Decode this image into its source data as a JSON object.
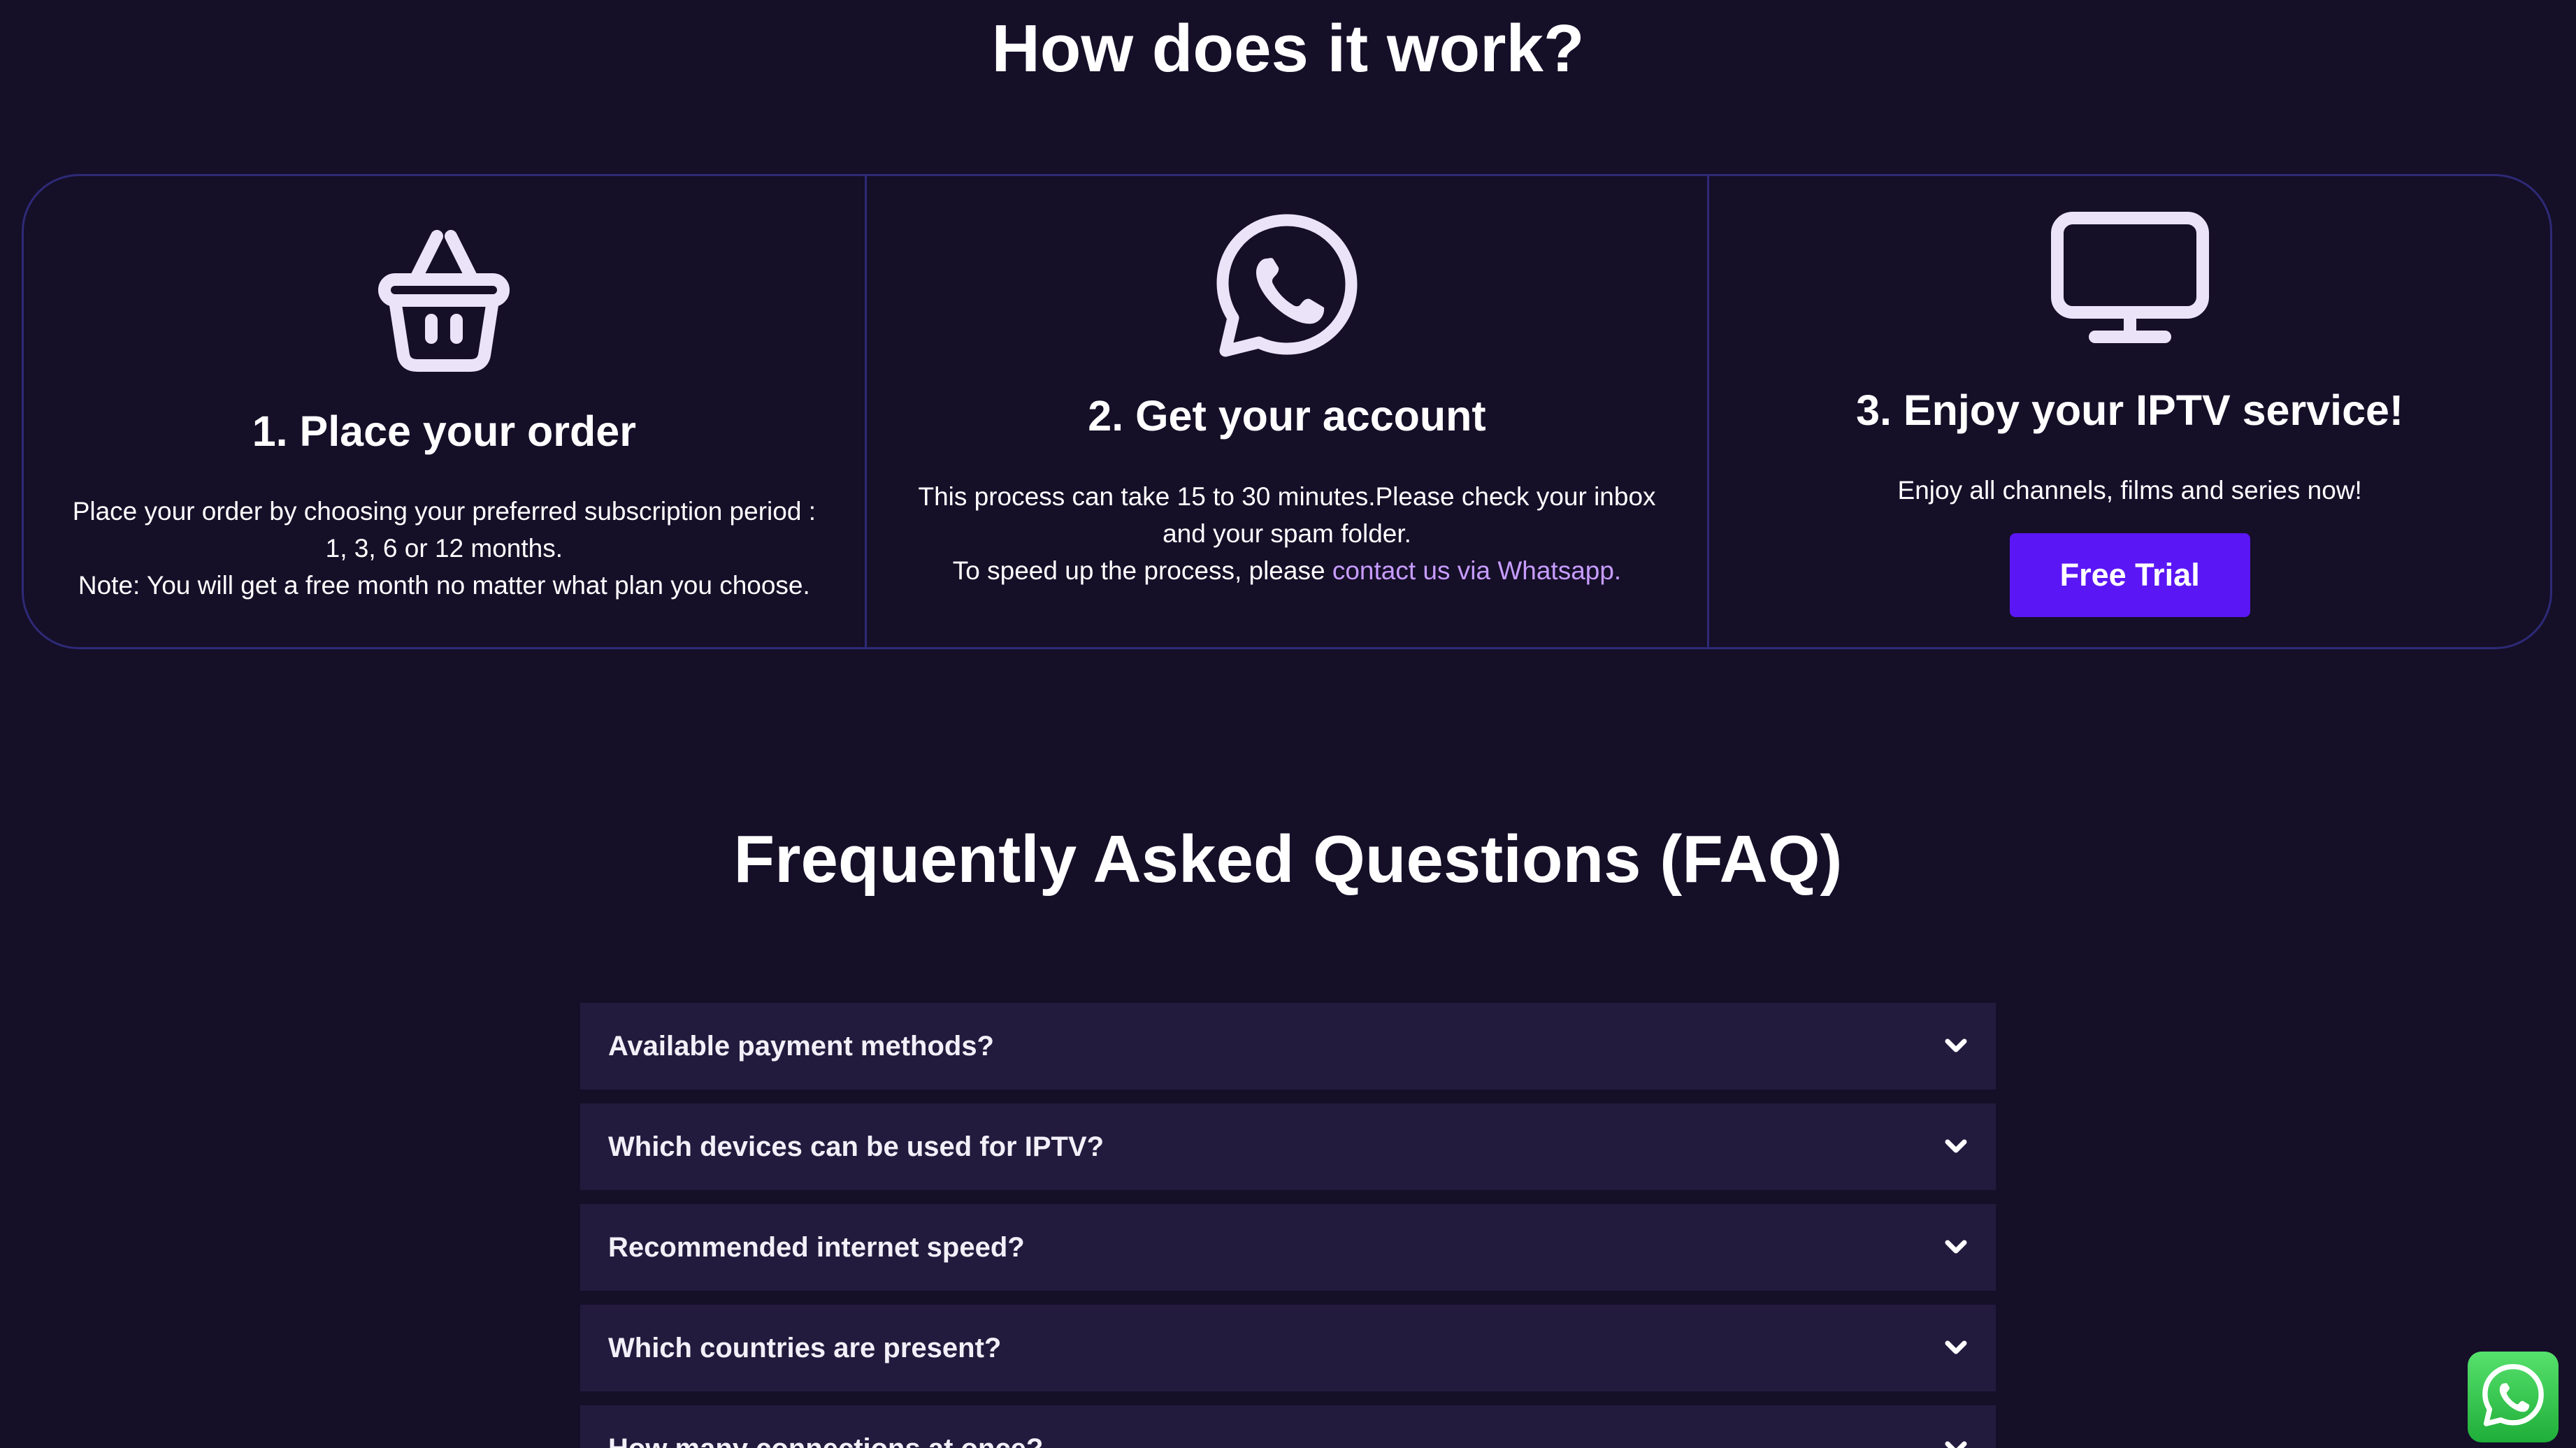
{
  "how_it_works": {
    "title": "How does it work?",
    "steps": [
      {
        "icon": "basket-icon",
        "title": "1. Place your order",
        "description": [
          "Place your order by choosing your preferred subscription period :",
          "1, 3, 6 or 12 months.",
          "Note: You will get a free month no matter what plan you choose."
        ]
      },
      {
        "icon": "whatsapp-icon",
        "title": "2. Get your account",
        "description": [
          "This process can take 15 to 30 minutes.Please check your inbox",
          "and your spam folder."
        ],
        "speed_up_text": "To speed up the process, please ",
        "link_text": "contact us via Whatsapp."
      },
      {
        "icon": "monitor-icon",
        "title": "3. Enjoy your IPTV service!",
        "description": [
          "Enjoy all channels, films and series now!"
        ],
        "button_label": "Free Trial"
      }
    ]
  },
  "faq": {
    "title": "Frequently Asked Questions (FAQ)",
    "items": [
      {
        "question": "Available payment methods?"
      },
      {
        "question": "Which devices can be used for IPTV?"
      },
      {
        "question": "Recommended internet speed?"
      },
      {
        "question": "Which countries are present?"
      },
      {
        "question": "How many connections at once?"
      }
    ]
  },
  "floating_whatsapp": {
    "icon": "whatsapp-icon"
  },
  "colors": {
    "background": "#150f28",
    "card_border": "#2e2a77",
    "accent_button": "#5b16f5",
    "link": "#c79cff",
    "faq_item_bg": "#231b3e",
    "whatsapp_green": "#25d366"
  }
}
